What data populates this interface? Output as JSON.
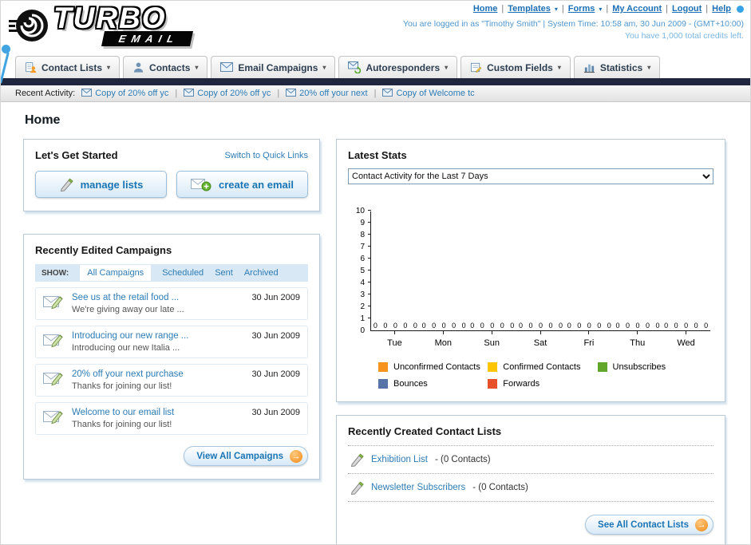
{
  "brand": {
    "name_top": "TURBO",
    "name_bottom": "EMAIL"
  },
  "topbar": {
    "links": [
      {
        "label": "Home",
        "dropdown": false
      },
      {
        "label": "Templates",
        "dropdown": true
      },
      {
        "label": "Forms",
        "dropdown": true
      },
      {
        "label": "My Account",
        "dropdown": false
      },
      {
        "label": "Logout",
        "dropdown": false
      },
      {
        "label": "Help",
        "dropdown": false
      }
    ],
    "login_info": "You are logged in as \"Timothy Smith\" | System Time: 10:58 am, 30 Jun 2009 - (GMT+10:00)",
    "credits": "You have 1,000 total credits left."
  },
  "nav_tabs": [
    {
      "label": "Contact Lists",
      "icon": "contact-lists-icon"
    },
    {
      "label": "Contacts",
      "icon": "contacts-icon"
    },
    {
      "label": "Email Campaigns",
      "icon": "email-campaigns-icon"
    },
    {
      "label": "Autoresponders",
      "icon": "autoresponders-icon"
    },
    {
      "label": "Custom Fields",
      "icon": "custom-fields-icon"
    },
    {
      "label": "Statistics",
      "icon": "statistics-icon"
    }
  ],
  "recent_activity": {
    "label": "Recent Activity:",
    "items": [
      "Copy of 20% off yc",
      "Copy of 20% off yc",
      "20% off your next",
      "Copy of Welcome tc"
    ]
  },
  "page_title": "Home",
  "get_started": {
    "title": "Let's Get Started",
    "switch_link": "Switch to Quick Links",
    "buttons": [
      {
        "label": "manage lists",
        "icon": "pencil-icon"
      },
      {
        "label": "create an email",
        "icon": "envelope-plus-icon"
      }
    ]
  },
  "campaigns": {
    "title": "Recently Edited Campaigns",
    "show_label": "SHOW:",
    "tabs": [
      {
        "label": "All Campaigns",
        "active": true
      },
      {
        "label": "Scheduled",
        "active": false
      },
      {
        "label": "Sent",
        "active": false
      },
      {
        "label": "Archived",
        "active": false
      }
    ],
    "items": [
      {
        "title": "See us at the retail food ...",
        "subtitle": "We're giving away our late ...",
        "date": "30 Jun 2009"
      },
      {
        "title": "Introducing our new range ...",
        "subtitle": "Introducing our new Italia ...",
        "date": "30 Jun 2009"
      },
      {
        "title": "20% off your next purchase",
        "subtitle": "Thanks for joining our list!",
        "date": "30 Jun 2009"
      },
      {
        "title": "Welcome to our email list",
        "subtitle": "Thanks for joining our list!",
        "date": "30 Jun 2009"
      }
    ],
    "view_all_label": "View All Campaigns"
  },
  "stats": {
    "title": "Latest Stats",
    "dropdown_value": "Contact Activity for the Last 7 Days"
  },
  "chart_data": {
    "type": "bar",
    "title": "Contact Activity for the Last 7 Days",
    "categories": [
      "Tue",
      "Mon",
      "Sun",
      "Sat",
      "Fri",
      "Thu",
      "Wed"
    ],
    "series": [
      {
        "name": "Unconfirmed Contacts",
        "color": "#f7941d",
        "values": [
          0,
          0,
          0,
          0,
          0,
          0,
          0
        ]
      },
      {
        "name": "Confirmed Contacts",
        "color": "#fdc500",
        "values": [
          0,
          0,
          0,
          0,
          0,
          0,
          0
        ]
      },
      {
        "name": "Unsubscribes",
        "color": "#61a72c",
        "values": [
          0,
          0,
          0,
          0,
          0,
          0,
          0
        ]
      },
      {
        "name": "Bounces",
        "color": "#5674a7",
        "values": [
          0,
          0,
          0,
          0,
          0,
          0,
          0
        ]
      },
      {
        "name": "Forwards",
        "color": "#e8502a",
        "values": [
          0,
          0,
          0,
          0,
          0,
          0,
          0
        ]
      }
    ],
    "ylim": [
      0,
      10
    ],
    "ytick_step": 1,
    "legend_position": "bottom",
    "grid": false
  },
  "contact_lists": {
    "title": "Recently Created Contact Lists",
    "items": [
      {
        "name": "Exhibition List",
        "detail": "- (0 Contacts)"
      },
      {
        "name": "Newsletter Subscribers",
        "detail": "- (0 Contacts)"
      }
    ],
    "see_all_label": "See All Contact Lists"
  }
}
